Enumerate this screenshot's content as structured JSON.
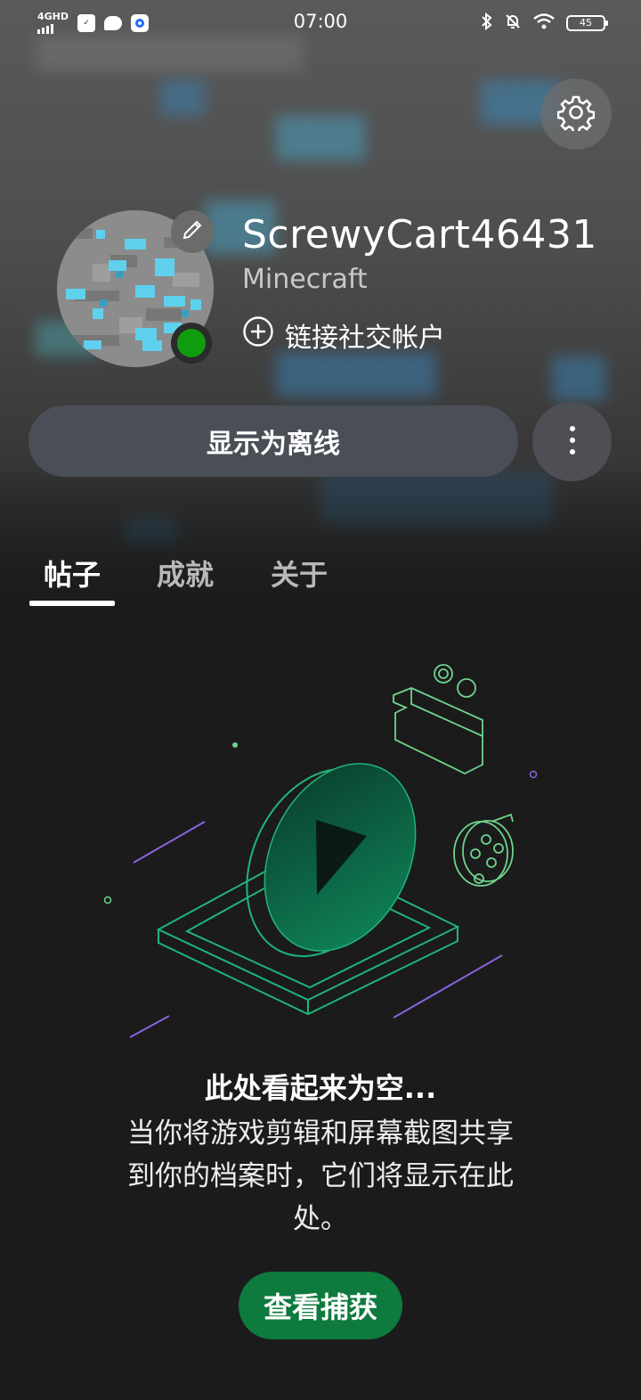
{
  "status_bar": {
    "network": "4GHD",
    "time": "07:00",
    "battery": "45"
  },
  "profile": {
    "gamertag": "ScrewyCart46431",
    "game": "Minecraft",
    "link_social_label": "链接社交帐户",
    "presence": "online"
  },
  "actions": {
    "appear_offline_label": "显示为离线"
  },
  "tabs": [
    {
      "label": "帖子",
      "active": true
    },
    {
      "label": "成就",
      "active": false
    },
    {
      "label": "关于",
      "active": false
    }
  ],
  "empty_state": {
    "title": "此处看起来为空...",
    "body": "当你将游戏剪辑和屏幕截图共享到你的档案时，它们将显示在此处。",
    "button_label": "查看捕获"
  },
  "colors": {
    "accent_green": "#0e7a3e",
    "presence_green": "#0f9d0f",
    "illustration_green": "#1fb57a",
    "illustration_purple": "#8a63e0"
  }
}
